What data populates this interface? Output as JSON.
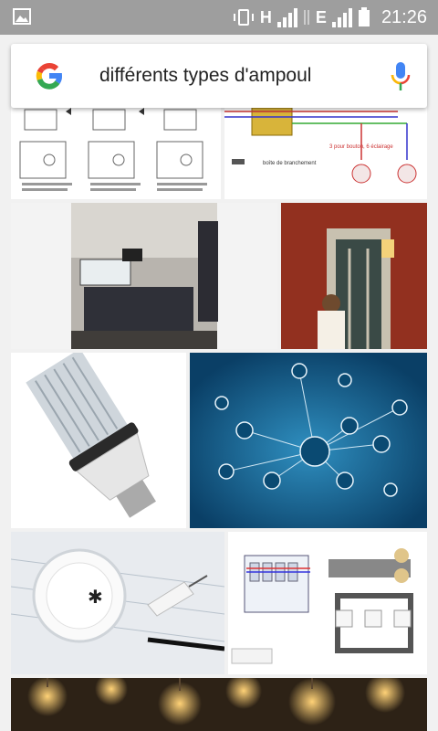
{
  "status_bar": {
    "network_1": "H",
    "network_2": "E",
    "time": "21:26"
  },
  "search": {
    "query": "différents types d'ampoul"
  },
  "results": [
    {
      "id": "r1",
      "label": "3 pour bouton, 6 éclairage",
      "sublabel": "boîte de branchement"
    },
    {
      "id": "r2"
    },
    {
      "id": "r3"
    },
    {
      "id": "r4"
    },
    {
      "id": "r5"
    },
    {
      "id": "r6"
    },
    {
      "id": "r7"
    },
    {
      "id": "r8"
    },
    {
      "id": "r9"
    }
  ]
}
